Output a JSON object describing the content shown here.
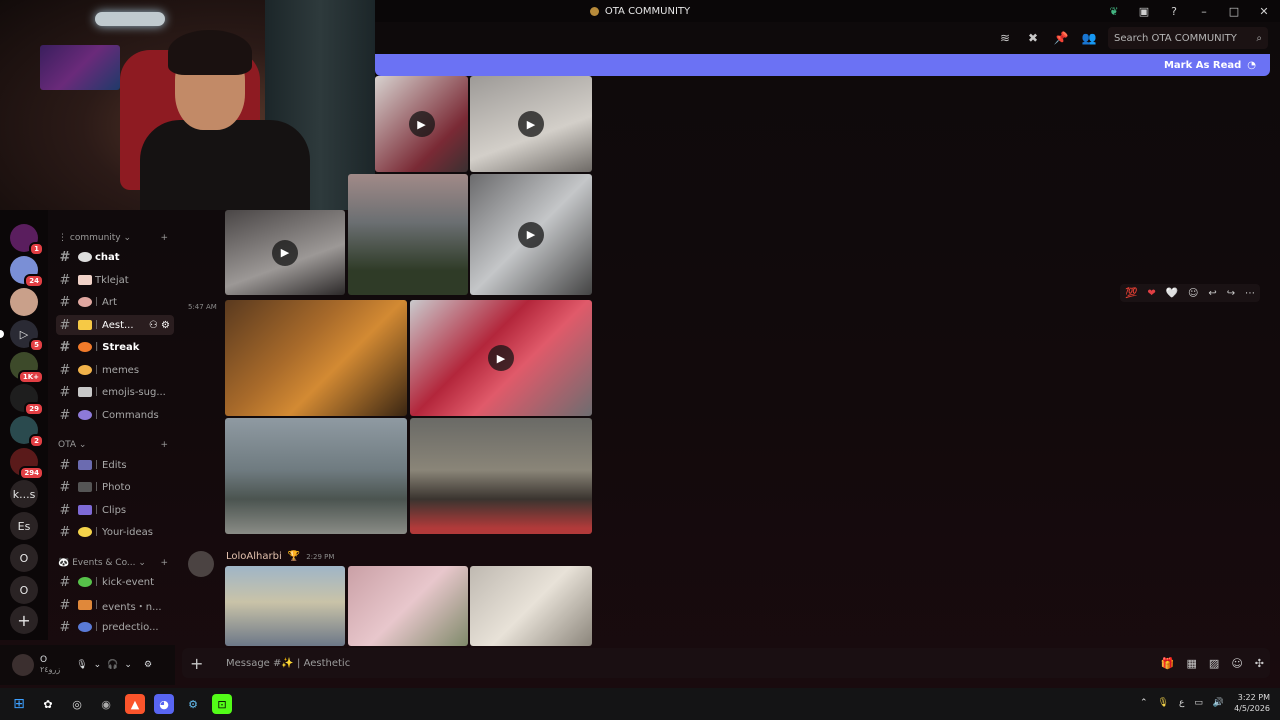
{
  "window": {
    "title": "OTA COMMUNITY"
  },
  "header": {
    "search_placeholder": "Search OTA COMMUNITY",
    "mark_as_read": "Mark As Read"
  },
  "categories": [
    {
      "name": "community"
    },
    {
      "name": "OTA"
    },
    {
      "name": "Events & Co..."
    }
  ],
  "channels": [
    {
      "label": "chat"
    },
    {
      "label": "Tklejat"
    },
    {
      "label": "Art"
    },
    {
      "label": "Aest..."
    },
    {
      "label": "Streak"
    },
    {
      "label": "memes"
    },
    {
      "label": "emojis-sug..."
    },
    {
      "label": "Commands"
    },
    {
      "label": "Edits"
    },
    {
      "label": "Photo"
    },
    {
      "label": "Clips"
    },
    {
      "label": "Your-ideas"
    },
    {
      "label": "kick-event"
    },
    {
      "label": "events・n..."
    },
    {
      "label": "predectio..."
    }
  ],
  "servers": [
    {
      "badge": "1"
    },
    {
      "badge": "24"
    },
    {
      "badge": ""
    },
    {
      "badge": "5"
    },
    {
      "badge": "1K+"
    },
    {
      "badge": "29"
    },
    {
      "badge": "2"
    },
    {
      "badge": "294"
    },
    {
      "label": "k...s"
    },
    {
      "label": "Es"
    },
    {
      "label": "O"
    },
    {
      "label": "O"
    }
  ],
  "messages": {
    "time_1": "5:47 AM",
    "author": "LoloAlharbi",
    "author_time": "2:29 PM"
  },
  "reactions": {
    "r1": "💯",
    "r2": "❤",
    "r3": "🤍"
  },
  "composer": {
    "placeholder": "Message #✨ | Aesthetic"
  },
  "user": {
    "name": "O",
    "status": "زرو٢٤"
  },
  "taskbar": {
    "time": "3:22 PM",
    "date": "4/5/2026",
    "lang": "ع"
  }
}
